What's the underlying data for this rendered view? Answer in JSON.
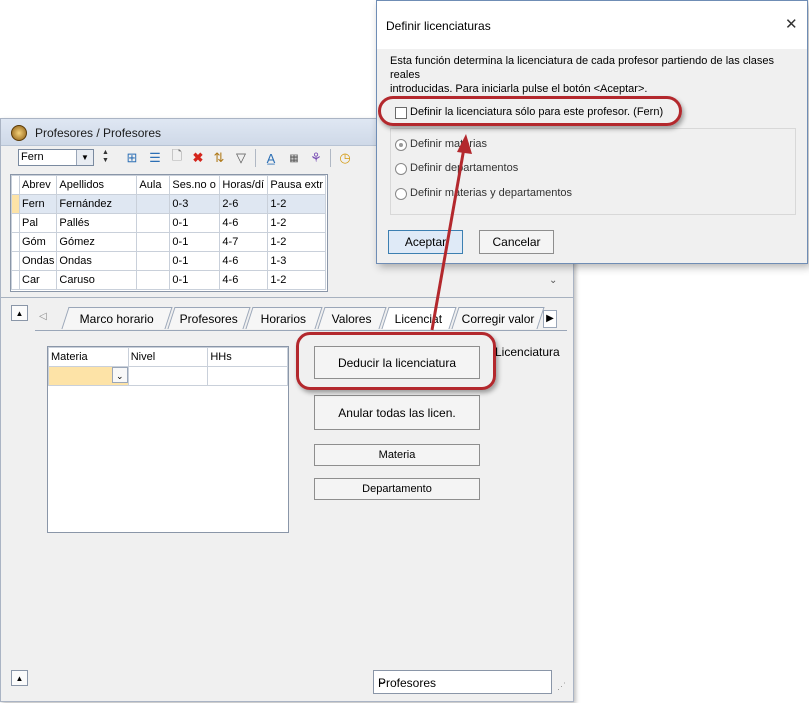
{
  "main_window": {
    "title": "Profesores / Profesores",
    "teacher_select_value": "Fern",
    "grid": {
      "columns": [
        "Abrev",
        "Apellidos",
        "Aula",
        "Ses.no o",
        "Horas/dí",
        "Pausa extr"
      ],
      "rows": [
        [
          "Fern",
          "Fernández",
          "",
          "0-3",
          "2-6",
          "1-2"
        ],
        [
          "Pal",
          "Pallés",
          "",
          "0-1",
          "4-6",
          "1-2"
        ],
        [
          "Góm",
          "Gómez",
          "",
          "0-1",
          "4-7",
          "1-2"
        ],
        [
          "Ondas",
          "Ondas",
          "",
          "0-1",
          "4-6",
          "1-3"
        ],
        [
          "Car",
          "Caruso",
          "",
          "0-1",
          "4-6",
          "1-2"
        ]
      ]
    },
    "tabs": [
      "Marco horario",
      "Profesores",
      "Horarios",
      "Valores",
      "Licenciat",
      "Corregir valor"
    ],
    "sub_grid_columns": [
      "Materia",
      "Nivel",
      "HHs"
    ],
    "buttons": {
      "deducir": "Deducir la licenciatura",
      "anular": "Anular todas las licen.",
      "materia": "Materia",
      "departamento": "Departamento"
    },
    "licenciatura_label": "Licenciatura",
    "bottom_select_value": "Profesores"
  },
  "dialog": {
    "title": "Definir licenciaturas",
    "description_line1": "Esta función determina la licenciatura de cada profesor partiendo de las clases reales",
    "description_line2": "introducidas. Para iniciarla pulse el botón <Aceptar>.",
    "checkbox_label": "Definir la licenciatura sólo para este profesor. (Fern)",
    "options": [
      "Definir materias",
      "Definir departamentos",
      "Definir materias y departamentos"
    ],
    "ok_label": "Aceptar",
    "cancel_label": "Cancelar"
  },
  "colors": {
    "highlight": "#b3282d",
    "selected_cell": "#fde3a7",
    "selected_row": "#dfe7f2",
    "ok_button": "#dfeaf7"
  }
}
